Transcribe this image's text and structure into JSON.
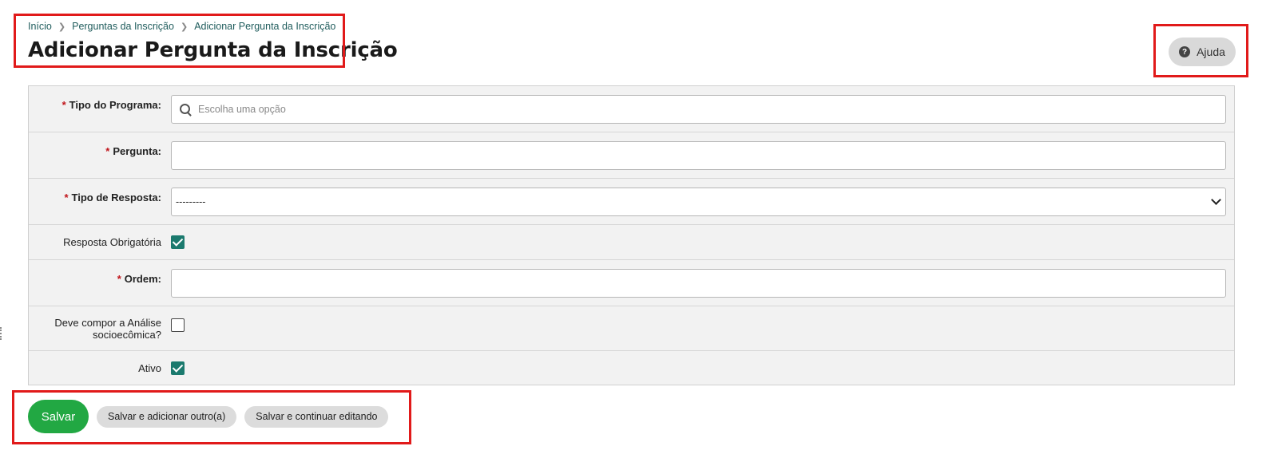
{
  "breadcrumb": [
    "Início",
    "Perguntas da Inscrição",
    "Adicionar Pergunta da Inscrição"
  ],
  "page_title": "Adicionar Pergunta da Inscrição",
  "help_button": "Ajuda",
  "form": {
    "tipo_programa": {
      "label": "Tipo do Programa:",
      "placeholder": "Escolha uma opção",
      "required": true
    },
    "pergunta": {
      "label": "Pergunta:",
      "value": "",
      "required": true
    },
    "tipo_resposta": {
      "label": "Tipo de Resposta:",
      "selected": "---------",
      "required": true
    },
    "resposta_obrigatoria": {
      "label": "Resposta Obrigatória",
      "checked": true
    },
    "ordem": {
      "label": "Ordem:",
      "value": "",
      "required": true
    },
    "analise": {
      "label_line1": "Deve compor a Análise",
      "label_line2": "socioecômica?",
      "checked": false
    },
    "ativo": {
      "label": "Ativo",
      "checked": true
    }
  },
  "actions": {
    "save": "Salvar",
    "save_add": "Salvar e adicionar outro(a)",
    "save_continue": "Salvar e continuar editando"
  },
  "colors": {
    "primary": "#22a843",
    "checkbox": "#1b7a6e",
    "highlight": "#e11a1a",
    "required_star": "#c0141a"
  }
}
